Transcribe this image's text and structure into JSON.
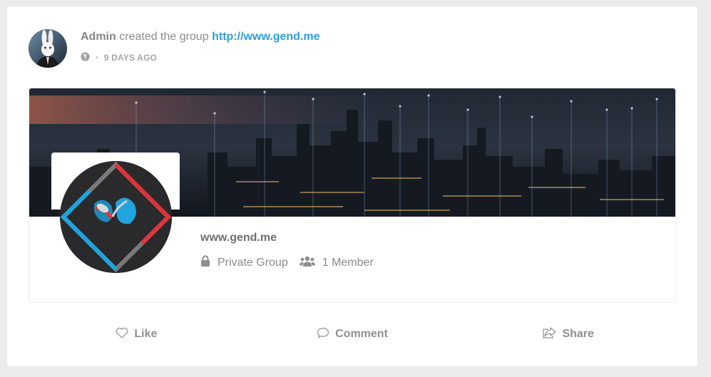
{
  "post": {
    "actor": "Admin",
    "action_text": "created the group",
    "link_text": "http://www.gend.me",
    "time": "9 DAYS AGO",
    "privacy_icon": "globe-icon"
  },
  "group": {
    "name": "www.gend.me",
    "privacy_label": "Private Group",
    "privacy_icon": "lock-icon",
    "members_label": "1 Member",
    "members_icon": "users-icon"
  },
  "actions": {
    "like_label": "Like",
    "comment_label": "Comment",
    "share_label": "Share"
  },
  "colors": {
    "link": "#2e9fd8",
    "card_bg": "#ffffff",
    "page_bg": "#ebebeb",
    "accent_red": "#e0353c",
    "accent_blue": "#1fa4de"
  }
}
